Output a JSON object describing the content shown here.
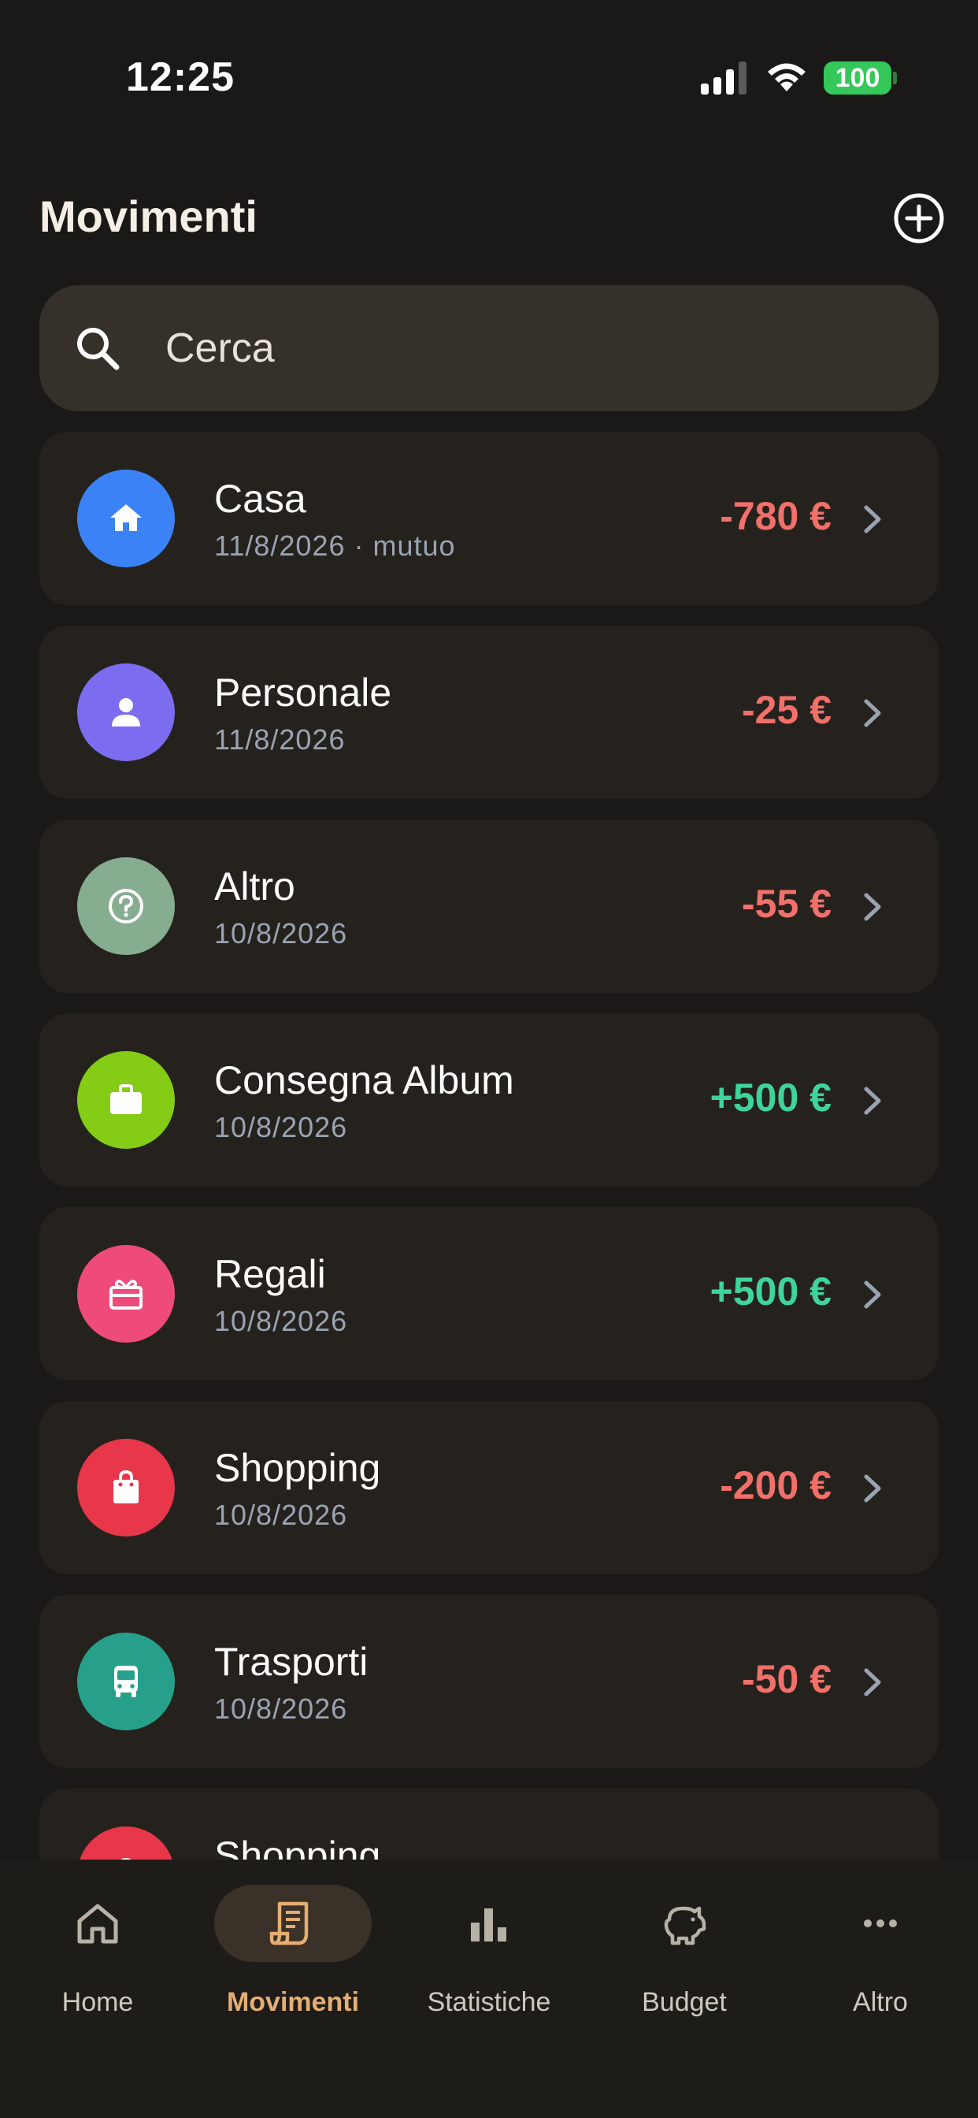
{
  "status_bar": {
    "time": "12:25",
    "battery": "100"
  },
  "header": {
    "title": "Movimenti",
    "add_icon": "plus-circle-icon"
  },
  "search": {
    "placeholder": "Cerca",
    "value": ""
  },
  "transactions": [
    {
      "name": "Casa",
      "meta": "11/8/2026 · mutuo",
      "amount": "-780 €",
      "sign": "neg",
      "icon": "home-icon",
      "color": "#3b82f6"
    },
    {
      "name": "Personale",
      "meta": "11/8/2026",
      "amount": "-25 €",
      "sign": "neg",
      "icon": "person-icon",
      "color": "#7c6cf0"
    },
    {
      "name": "Altro",
      "meta": "10/8/2026",
      "amount": "-55 €",
      "sign": "neg",
      "icon": "help-icon",
      "color": "#86ad8f"
    },
    {
      "name": "Consegna Album",
      "meta": "10/8/2026",
      "amount": "+500 €",
      "sign": "pos",
      "icon": "briefcase-icon",
      "color": "#84cc16"
    },
    {
      "name": "Regali",
      "meta": "10/8/2026",
      "amount": "+500 €",
      "sign": "pos",
      "icon": "gift-icon",
      "color": "#ee4b7b"
    },
    {
      "name": "Shopping",
      "meta": "10/8/2026",
      "amount": "-200 €",
      "sign": "neg",
      "icon": "shopping-bag-icon",
      "color": "#e8364a"
    },
    {
      "name": "Trasporti",
      "meta": "10/8/2026",
      "amount": "-50 €",
      "sign": "neg",
      "icon": "bus-icon",
      "color": "#26a08a"
    },
    {
      "name": "Shopping",
      "meta": "",
      "amount": "",
      "sign": "neg",
      "icon": "shopping-bag-icon",
      "color": "#e8364a"
    }
  ],
  "tab_bar": {
    "tabs": [
      {
        "label": "Home",
        "icon": "home-icon",
        "active": false
      },
      {
        "label": "Movimenti",
        "icon": "receipt-icon",
        "active": true
      },
      {
        "label": "Statistiche",
        "icon": "bar-chart-icon",
        "active": false
      },
      {
        "label": "Budget",
        "icon": "piggy-bank-icon",
        "active": false
      },
      {
        "label": "Altro",
        "icon": "more-icon",
        "active": false
      }
    ]
  },
  "colors": {
    "background": "#1a1917",
    "card": "#25221e",
    "accent": "#e6ad73",
    "negative": "#f2706a",
    "positive": "#3ed49a"
  }
}
